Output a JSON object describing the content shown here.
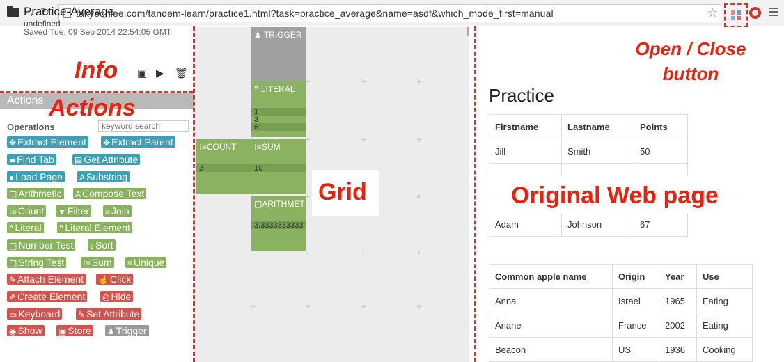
{
  "browser": {
    "back_icon": "arrow-left-icon",
    "forward_icon": "arrow-right-icon",
    "reload_icon": "reload-icon",
    "url": "takyeonlee.com/tandem-learn/practice1.html?task=practice_average&name=asdf&which_mode_first=manual",
    "accent": "#e0302c"
  },
  "project": {
    "title": "Practice-Average",
    "subtitle": "undefined",
    "saved": "Saved Tue, 09 Sep 2014 22:54:05 GMT"
  },
  "annotations": {
    "info": "Info",
    "actions": "Actions",
    "grid": "Grid",
    "original": "Original Web page",
    "open_close_line1": "Open / Close",
    "open_close_line2": "button"
  },
  "actions_panel": {
    "header": "Actions",
    "operations_label": "Operations",
    "search_placeholder": "keyword search"
  },
  "operations": [
    {
      "label": "Extract Element",
      "icon": "✥",
      "color": "teal"
    },
    {
      "label": "Extract Parent",
      "icon": "✥",
      "color": "teal"
    },
    {
      "label": "Find Tab",
      "icon": "▰",
      "color": "teal"
    },
    {
      "label": "Get Attribute",
      "icon": "▤",
      "color": "teal"
    },
    {
      "label": "Load Page",
      "icon": "●",
      "color": "teal"
    },
    {
      "label": "Substring",
      "icon": "A",
      "color": "teal"
    },
    {
      "label": "Arithmetic",
      "icon": "◫",
      "color": "green"
    },
    {
      "label": "Compose Text",
      "icon": "A",
      "color": "green"
    },
    {
      "label": "Count",
      "icon": "⁝≡",
      "color": "green"
    },
    {
      "label": "Filter",
      "icon": "▼",
      "color": "green"
    },
    {
      "label": "Join",
      "icon": "≡",
      "color": "green"
    },
    {
      "label": "Literal",
      "icon": "❞",
      "color": "green"
    },
    {
      "label": "Literal Element",
      "icon": "❞",
      "color": "green"
    },
    {
      "label": "Number Test",
      "icon": "◫",
      "color": "green"
    },
    {
      "label": "Sort",
      "icon": "↓",
      "color": "green"
    },
    {
      "label": "String Test",
      "icon": "◫",
      "color": "green"
    },
    {
      "label": "Sum",
      "icon": "⁝≡",
      "color": "green"
    },
    {
      "label": "Unique",
      "icon": "≡",
      "color": "green"
    },
    {
      "label": "Attach Element",
      "icon": "✎",
      "color": "red"
    },
    {
      "label": "Click",
      "icon": "☝",
      "color": "red"
    },
    {
      "label": "Create Element",
      "icon": "✐",
      "color": "red"
    },
    {
      "label": "Hide",
      "icon": "◎",
      "color": "red"
    },
    {
      "label": "Keyboard",
      "icon": "▭",
      "color": "red"
    },
    {
      "label": "Set Attribute",
      "icon": "✎",
      "color": "red"
    },
    {
      "label": "Show",
      "icon": "◉",
      "color": "red"
    },
    {
      "label": "Store",
      "icon": "▣",
      "color": "red"
    },
    {
      "label": "Trigger",
      "icon": "♟",
      "color": "grey"
    }
  ],
  "grid": {
    "trigger": {
      "label": "TRIGGER",
      "icon": "bell-icon"
    },
    "literal": {
      "label": "LITERAL",
      "icon": "quote-icon",
      "values": [
        "1",
        "3",
        "6"
      ]
    },
    "count": {
      "label": "COUNT",
      "icon": "list-icon",
      "value": "3"
    },
    "sum": {
      "label": "SUM",
      "icon": "list-icon",
      "value": "10"
    },
    "arithmetic": {
      "label": "ARITHMET",
      "icon": "columns-icon",
      "value": "3.3333333333"
    }
  },
  "page": {
    "heading": "Practice",
    "people_table": {
      "headers": [
        "Firstname",
        "Lastname",
        "Points"
      ],
      "rows": [
        [
          "Jill",
          "Smith",
          "50"
        ],
        [
          "Adam",
          "Johnson",
          "67"
        ]
      ]
    },
    "apple_table": {
      "headers": [
        "Common apple name",
        "Origin",
        "Year",
        "Use"
      ],
      "rows": [
        [
          "Anna",
          "Israel",
          "1965",
          "Eating"
        ],
        [
          "Ariane",
          "France",
          "2002",
          "Eating"
        ],
        [
          "Beacon",
          "US",
          "1936",
          "Cooking"
        ]
      ]
    }
  }
}
